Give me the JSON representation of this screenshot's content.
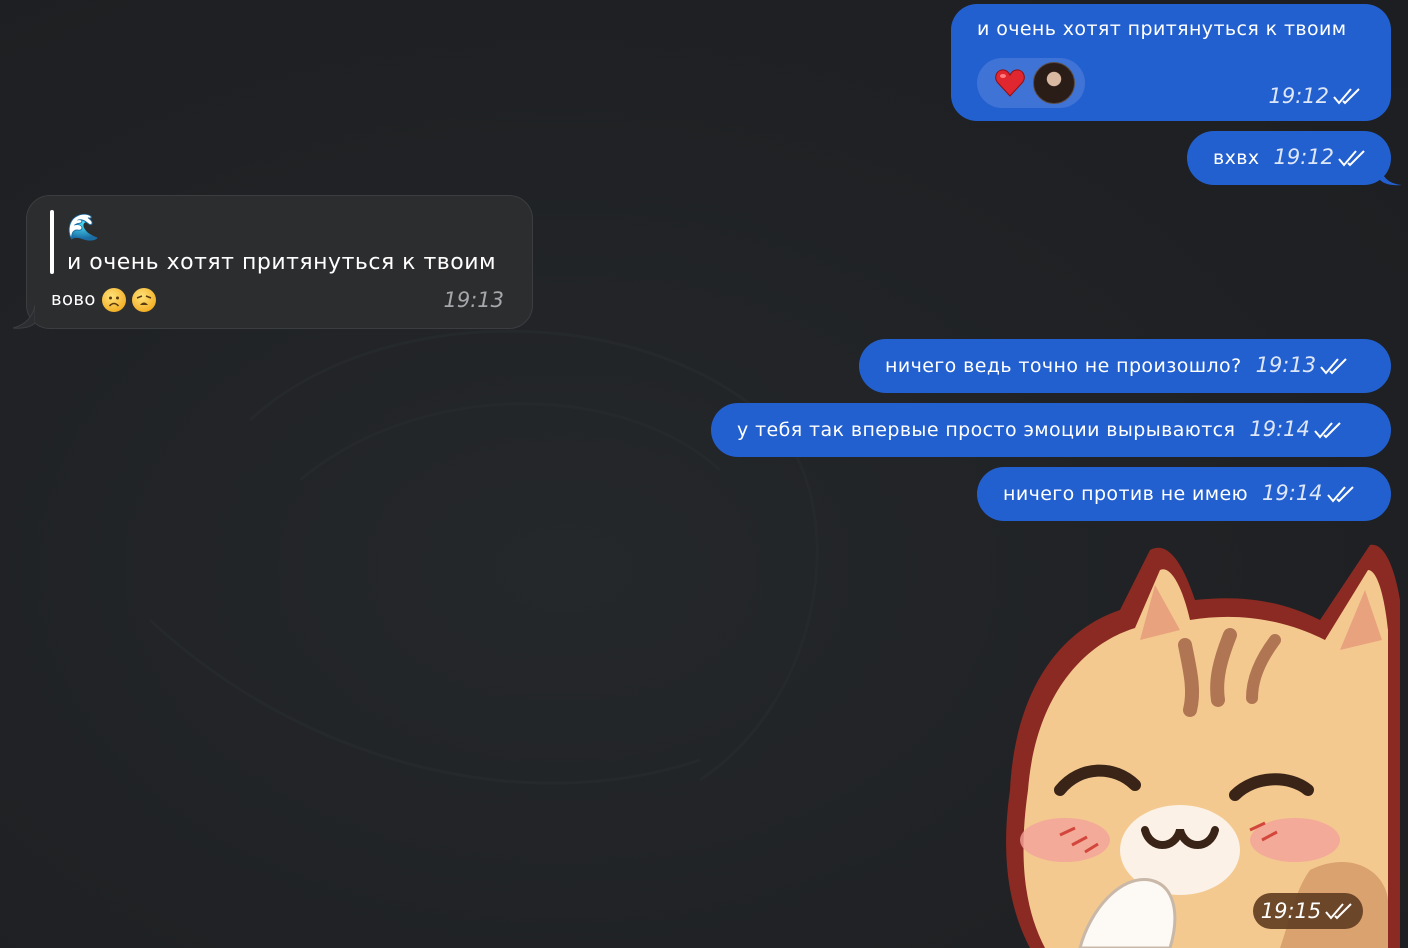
{
  "messages": {
    "m1": {
      "text": "и очень хотят притянуться к твоим",
      "time": "19:12",
      "reaction_icon": "heart-icon"
    },
    "m2": {
      "text": "вхвх",
      "time": "19:12"
    },
    "m3": {
      "quote_emoji": "🌊",
      "quote_text": "и очень хотят притянуться к твоим",
      "text": "вово",
      "emojis": [
        "sad-face-icon",
        "weary-face-icon"
      ],
      "time": "19:13"
    },
    "m4": {
      "text": "ничего ведь точно не произошло?",
      "time": "19:13"
    },
    "m5": {
      "text": "у тебя так впервые просто эмоции вырываются",
      "time": "19:14"
    },
    "m6": {
      "text": "ничего против не имею",
      "time": "19:14"
    },
    "m7": {
      "sticker": "cat-sticker",
      "time": "19:15"
    }
  },
  "colors": {
    "background": "#1f2124",
    "outgoing_bubble": "#2360cf",
    "incoming_bubble": "#2c2d2f",
    "reaction_pill": "#3f73d6"
  }
}
